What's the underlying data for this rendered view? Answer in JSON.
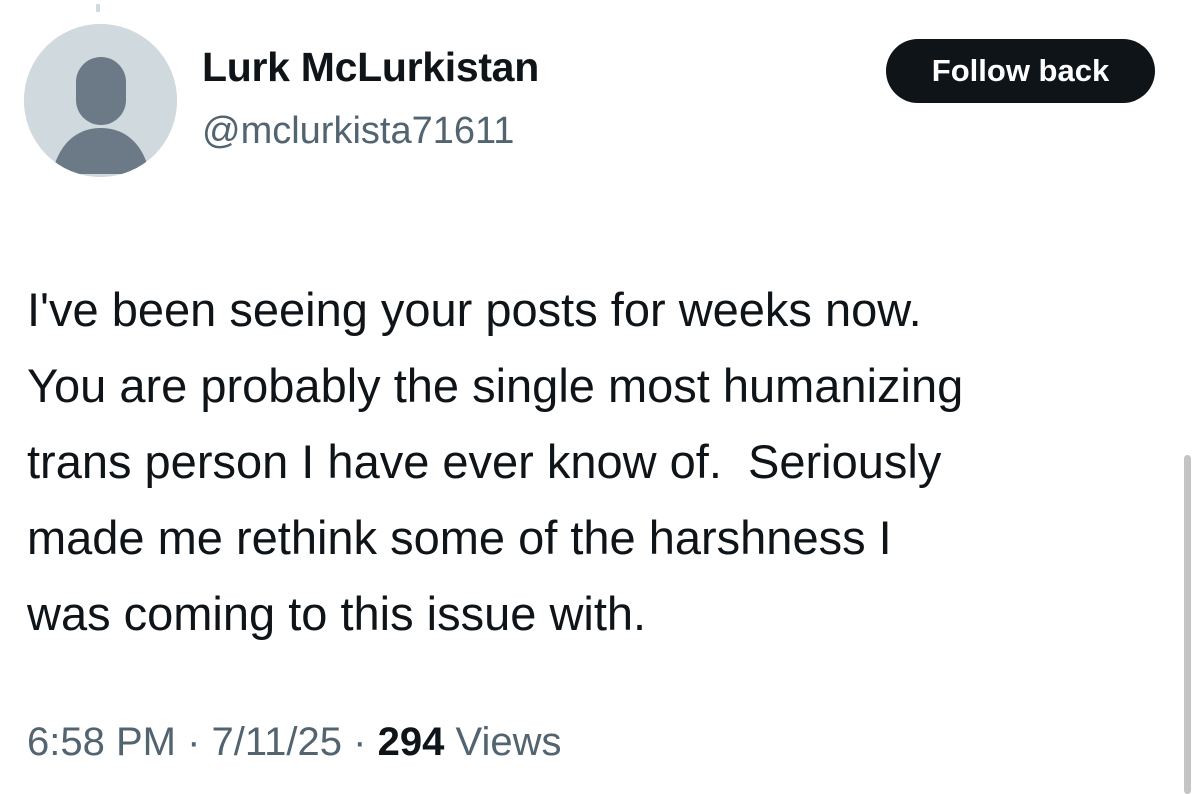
{
  "user": {
    "display_name": "Lurk McLurkistan",
    "handle": "@mclurkista71611"
  },
  "follow_button": {
    "label": "Follow back"
  },
  "tweet": {
    "lines": [
      "I've been seeing your posts for weeks now.",
      "You are probably the single most humanizing",
      "trans person I have ever know of.  Seriously",
      "made me rethink some of the harshness I",
      "was coming to this issue with."
    ]
  },
  "meta": {
    "time": "6:58 PM",
    "separator": "·",
    "date": "7/11/25",
    "views_count": "294",
    "views_label": "Views"
  },
  "colors": {
    "text_primary": "#0f1419",
    "text_secondary": "#536471",
    "avatar_bg": "#cfd9de",
    "avatar_figure": "#6b7a86",
    "button_bg": "#0f1419",
    "button_text": "#ffffff"
  },
  "icons": {
    "avatar": "default-profile-icon"
  }
}
